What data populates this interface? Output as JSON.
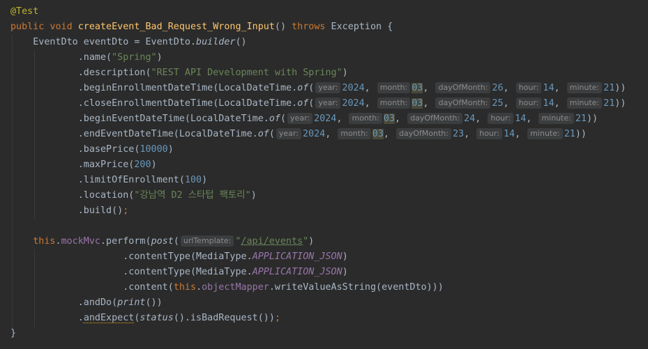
{
  "code": {
    "annotation": "@Test",
    "sig_public": "public",
    "sig_void": "void",
    "method_name": "createEvent_Bad_Request_Wrong_Input",
    "sig_parens": "()",
    "sig_throws": "throws",
    "sig_exception": "Exception {",
    "dto_decl": "EventDto eventDto = EventDto.",
    "builder_call": "builder",
    "builder_parens": "()",
    "name_call": ".name(",
    "name_value": "\"Spring\"",
    "description_call": ".description(",
    "description_value": "\"REST API Development with Spring\"",
    "begin_enroll_call": ".beginEnrollmentDateTime(LocalDateTime.",
    "close_enroll_call": ".closeEnrollmentDateTime(LocalDateTime.",
    "begin_event_call": ".beginEventDateTime(LocalDateTime.",
    "end_event_call": ".endEventDateTime(LocalDateTime.",
    "of_call": "of",
    "begin_enroll": {
      "year": "2024",
      "month": "03",
      "day": "26",
      "hour": "14",
      "minute": "21"
    },
    "close_enroll": {
      "year": "2024",
      "month": "03",
      "day": "25",
      "hour": "14",
      "minute": "21"
    },
    "begin_event": {
      "year": "2024",
      "month": "03",
      "day": "24",
      "hour": "14",
      "minute": "21"
    },
    "end_event": {
      "year": "2024",
      "month": "03",
      "day": "23",
      "hour": "14",
      "minute": "21"
    },
    "hint_year": "year:",
    "hint_month": "month:",
    "hint_day": "dayOfMonth:",
    "hint_hour": "hour:",
    "hint_minute": "minute:",
    "base_price_call": ".basePrice(",
    "base_price_value": "10000",
    "max_price_call": ".maxPrice(",
    "max_price_value": "200",
    "limit_call": ".limitOfEnrollment(",
    "limit_value": "100",
    "location_call": ".location(",
    "location_value": "\"강남역 D2 스타텁 팩토리\"",
    "build_call": ".build()",
    "this_kw": "this",
    "mock_field": "mockMvc",
    "perform_call": ".perform(",
    "post_call": "post",
    "hint_url": "urlTemplate:",
    "url_value": "/api/events",
    "content_type_call": ".contentType(MediaType.",
    "json_const": "APPLICATION_JSON",
    "content_call": ".content(",
    "mapper_field": "objectMapper",
    "write_call": ".writeValueAsString(eventDto)))",
    "and_do": ".andDo(",
    "print_call": "print",
    "and_expect": "andExpect",
    "status_call": "status",
    "bad_request": "().isBadRequest())",
    "closing_brace": "}"
  }
}
